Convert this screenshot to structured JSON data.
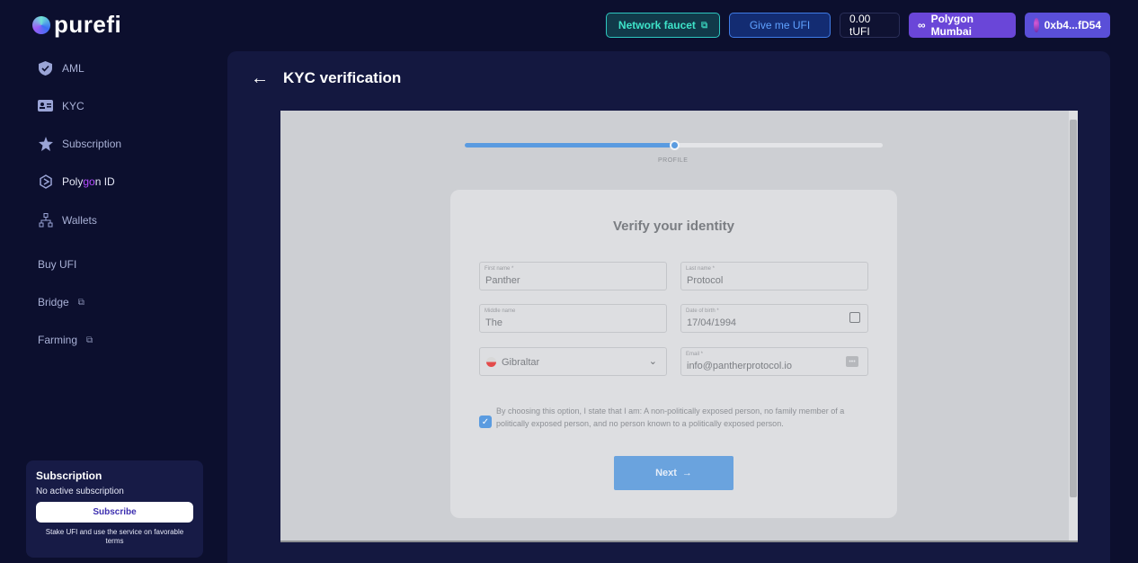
{
  "brand": {
    "name": "purefi"
  },
  "header": {
    "faucet_label": "Network faucet",
    "give_label": "Give me UFI",
    "balance": "0.00 tUFI",
    "network": "Polygon Mumbai",
    "wallet": "0xb4...fD54"
  },
  "sidebar": {
    "items": [
      {
        "label": "AML",
        "icon": "shield-icon"
      },
      {
        "label": "KYC",
        "icon": "id-card-icon"
      },
      {
        "label": "Subscription",
        "icon": "star-icon"
      },
      {
        "label_a": "Poly",
        "label_b": "go",
        "label_c": "n ID",
        "icon": "polygon-id-icon"
      },
      {
        "label": "Wallets",
        "icon": "wallets-icon"
      }
    ],
    "links": [
      {
        "label": "Buy UFI"
      },
      {
        "label": "Bridge"
      },
      {
        "label": "Farming"
      }
    ]
  },
  "subscription": {
    "title": "Subscription",
    "status": "No active subscription",
    "button": "Subscribe",
    "note": "Stake UFI and use the service on favorable terms"
  },
  "page": {
    "title": "KYC verification"
  },
  "kyc": {
    "progress_label": "PROFILE",
    "progress": 0.5,
    "title": "Verify your identity",
    "fields": {
      "first_name": {
        "label": "First name *",
        "value": "Panther"
      },
      "last_name": {
        "label": "Last name *",
        "value": "Protocol"
      },
      "middle_name": {
        "label": "Middle name",
        "value": "The"
      },
      "dob": {
        "label": "Date of birth *",
        "value": "17/04/1994"
      },
      "country": {
        "value": "Gibraltar"
      },
      "email": {
        "label": "Email *",
        "value": "info@pantherprotocol.io"
      }
    },
    "consent": "By choosing this option, I state that I am: A non-politically exposed person, no family member of a politically exposed person, and no person known to a politically exposed person.",
    "next": "Next"
  }
}
